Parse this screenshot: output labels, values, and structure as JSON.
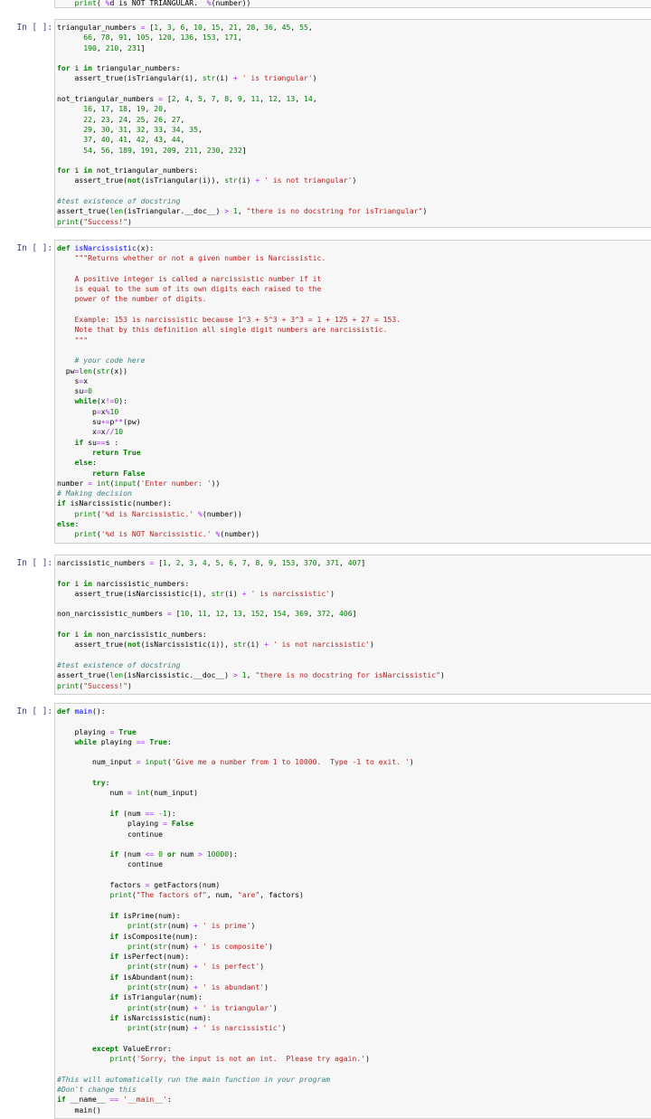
{
  "notebook": {
    "prompt": "In [ ]:",
    "cells": [
      {
        "prompt": "In [ ]:",
        "lines": [
          "    print( %d is NOT TRIANGULAR.  %(number))"
        ]
      },
      {
        "prompt": "In [ ]:",
        "lines": [
          "triangular_numbers = [1, 3, 6, 10, 15, 21, 28, 36, 45, 55,",
          "      66, 78, 91, 105, 120, 136, 153, 171,",
          "      190, 210, 231]",
          "",
          "for i in triangular_numbers:",
          "    assert_true(isTriangular(i), str(i) + ' is triangular')",
          "",
          "not_triangular_numbers = [2, 4, 5, 7, 8, 9, 11, 12, 13, 14,",
          "      16, 17, 18, 19, 20,",
          "      22, 23, 24, 25, 26, 27,",
          "      29, 30, 31, 32, 33, 34, 35,",
          "      37, 40, 41, 42, 43, 44,",
          "      54, 56, 189, 191, 209, 211, 230, 232]",
          "",
          "for i in not_triangular_numbers:",
          "    assert_true(not(isTriangular(i)), str(i) + ' is not triangular')",
          "",
          "#test existence of docstring",
          "assert_true(len(isTriangular.__doc__) > 1, \"there is no docstring for isTriangular\")",
          "print(\"Success!\")"
        ]
      },
      {
        "prompt": "In [ ]:",
        "lines": [
          "def isNarcissistic(x):",
          "    \"\"\"Returns whether or not a given number is Narcissistic.",
          "",
          "    A positive integer is called a narcissistic number if it",
          "    is equal to the sum of its own digits each raised to the",
          "    power of the number of digits.",
          "",
          "    Example: 153 is narcissistic because 1^3 + 5^3 + 3^3 = 1 + 125 + 27 = 153.",
          "    Note that by this definition all single digit numbers are narcissistic.",
          "    \"\"\"",
          "",
          "    # your code here",
          "  pw=len(str(x))",
          "    s=x",
          "    su=0",
          "    while(x!=0):",
          "        p=x%10",
          "        su+=p**(pw)",
          "        x=x//10",
          "    if su==s :",
          "        return True",
          "    else:",
          "        return False",
          "number = int(input('Enter number: '))",
          "# Making decision",
          "if isNarcissistic(number):",
          "    print('%d is Narcissistic.' %(number))",
          "else:",
          "    print('%d is NOT Narcissistic.' %(number))"
        ]
      },
      {
        "prompt": "In [ ]:",
        "lines": [
          "narcissistic_numbers = [1, 2, 3, 4, 5, 6, 7, 8, 9, 153, 370, 371, 407]",
          "",
          "for i in narcissistic_numbers:",
          "    assert_true(isNarcissistic(i), str(i) + ' is narcissistic')",
          "",
          "non_narcissistic_numbers = [10, 11, 12, 13, 152, 154, 369, 372, 406]",
          "",
          "for i in non_narcissistic_numbers:",
          "    assert_true(not(isNarcissistic(i)), str(i) + ' is not narcissistic')",
          "",
          "#test existence of docstring",
          "assert_true(len(isNarcissistic.__doc__) > 1, \"there is no docstring for isNarcissistic\")",
          "print(\"Success!\")"
        ]
      },
      {
        "prompt": "In [ ]:",
        "lines": [
          "def main():",
          "",
          "    playing = True",
          "    while playing == True:",
          "",
          "        num_input = input('Give me a number from 1 to 10000.  Type -1 to exit. ')",
          "",
          "        try:",
          "            num = int(num_input)",
          "",
          "            if (num == -1):",
          "                playing = False",
          "                continue",
          "",
          "            if (num <= 0 or num > 10000):",
          "                continue",
          "",
          "            factors = getFactors(num)",
          "            print(\"The factors of\", num, \"are\", factors)",
          "",
          "            if isPrime(num):",
          "                print(str(num) + ' is prime')",
          "            if isComposite(num):",
          "                print(str(num) + ' is composite')",
          "            if isPerfect(num):",
          "                print(str(num) + ' is perfect')",
          "            if isAbundant(num):",
          "                print(str(num) + ' is abundant')",
          "            if isTriangular(num):",
          "                print(str(num) + ' is triangular')",
          "            if isNarcissistic(num):",
          "                print(str(num) + ' is narcissistic')",
          "",
          "        except ValueError:",
          "            print('Sorry, the input is not an int.  Please try again.')",
          "",
          "#This will automatically run the main function in your program",
          "#Don't change this",
          "if __name__ == '__main__':",
          "    main()"
        ]
      }
    ]
  }
}
